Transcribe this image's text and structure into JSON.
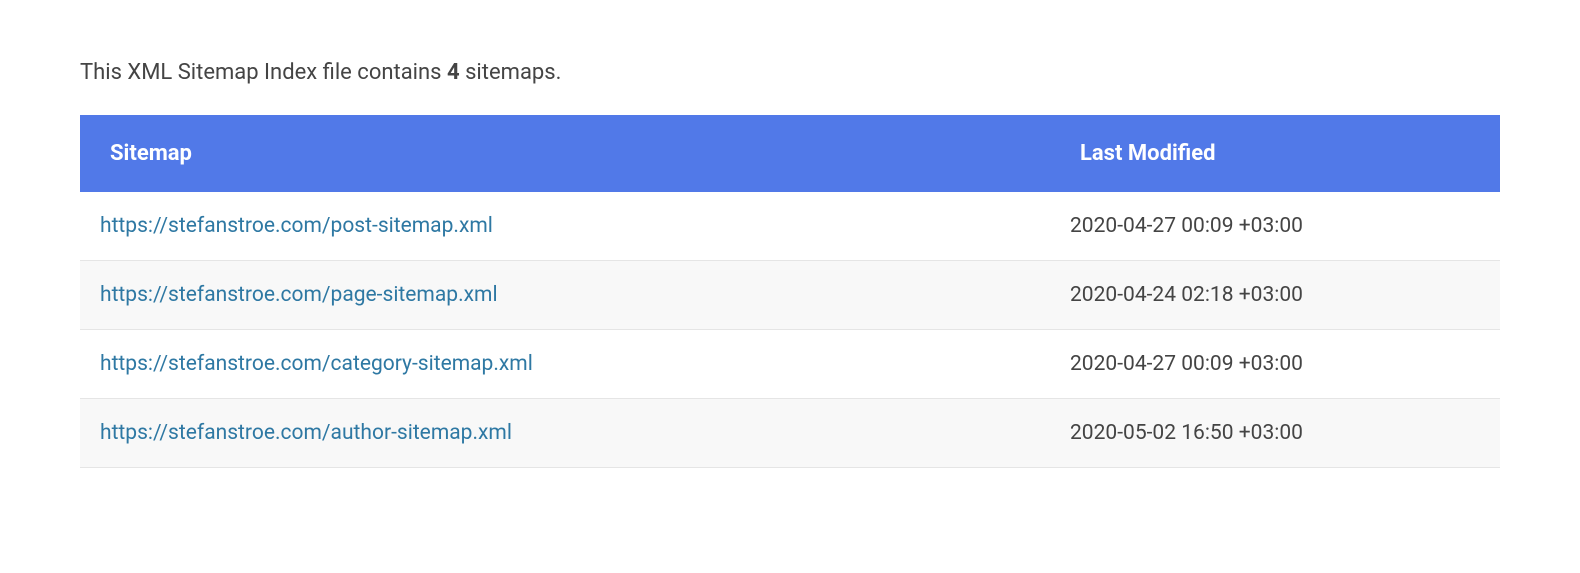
{
  "description": {
    "prefix": "This XML Sitemap Index file contains ",
    "count": "4",
    "suffix": " sitemaps."
  },
  "table": {
    "headers": {
      "sitemap": "Sitemap",
      "lastModified": "Last Modified"
    },
    "rows": [
      {
        "url": "https://stefanstroe.com/post-sitemap.xml",
        "lastModified": "2020-04-27 00:09 +03:00"
      },
      {
        "url": "https://stefanstroe.com/page-sitemap.xml",
        "lastModified": "2020-04-24 02:18 +03:00"
      },
      {
        "url": "https://stefanstroe.com/category-sitemap.xml",
        "lastModified": "2020-04-27 00:09 +03:00"
      },
      {
        "url": "https://stefanstroe.com/author-sitemap.xml",
        "lastModified": "2020-05-02 16:50 +03:00"
      }
    ]
  }
}
